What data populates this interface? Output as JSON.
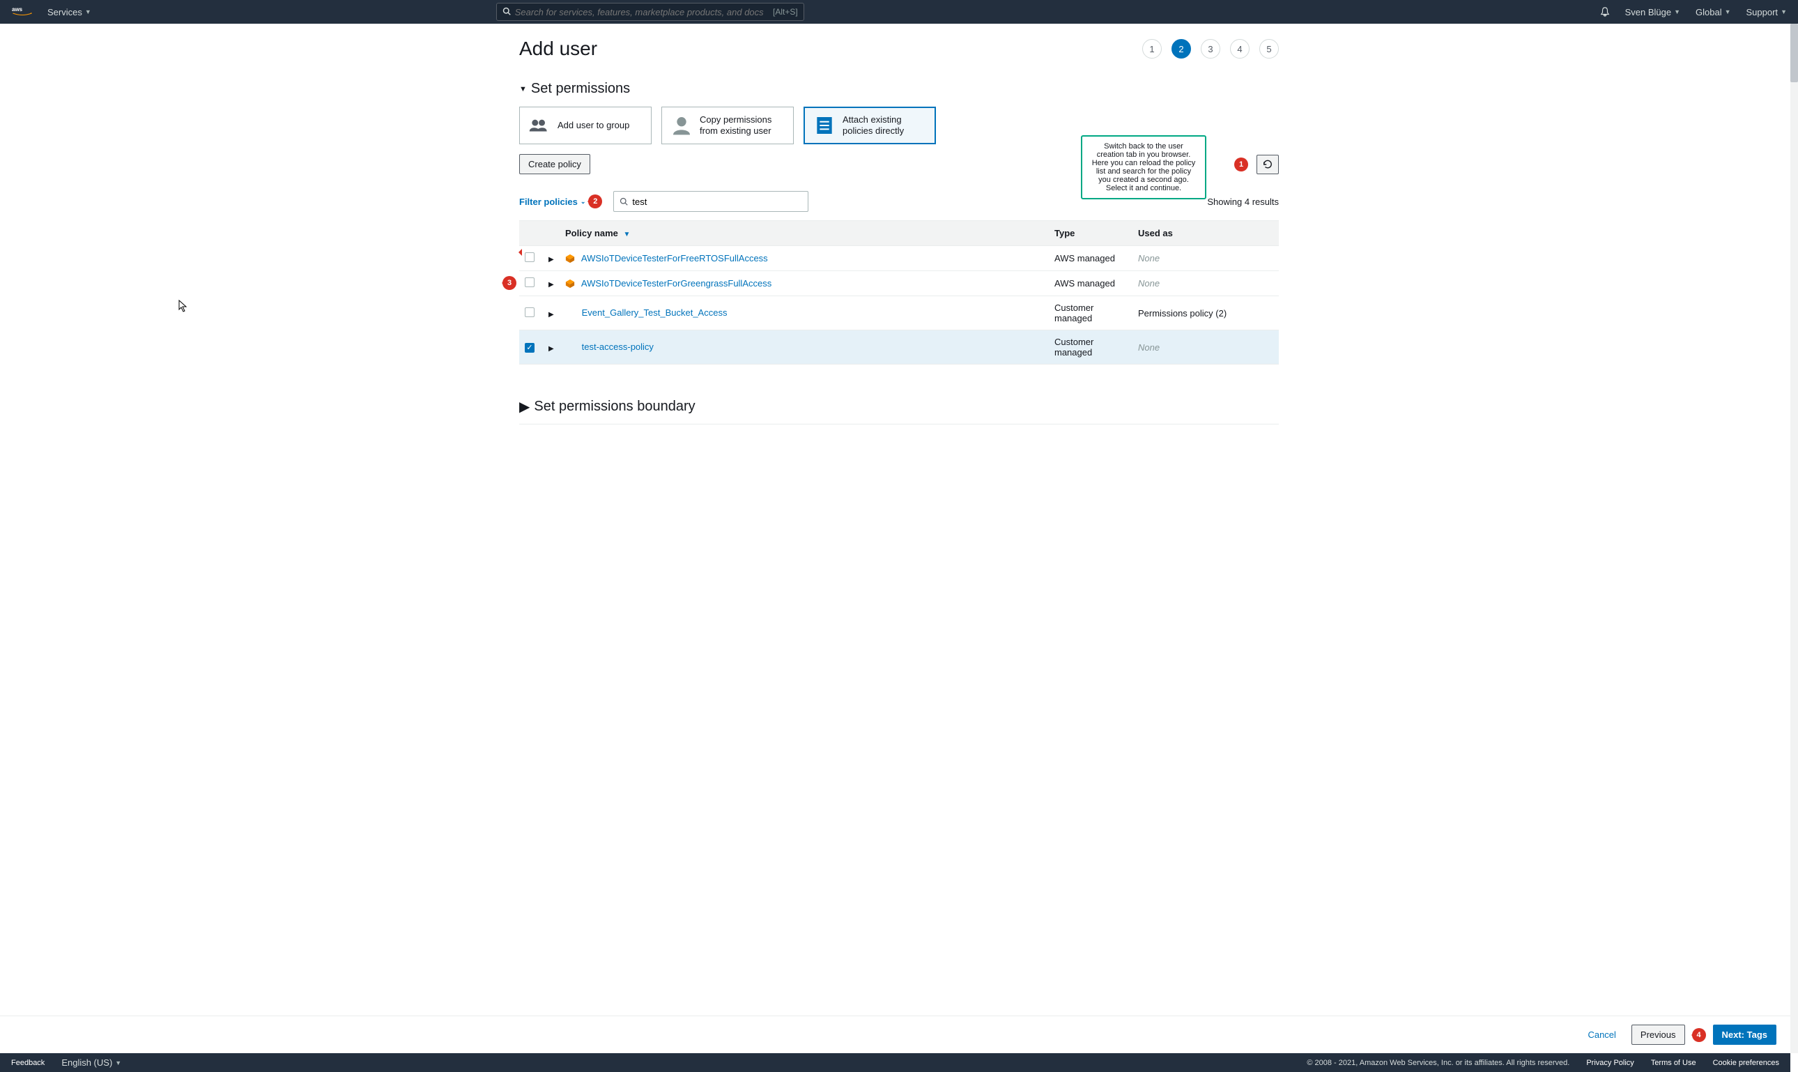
{
  "header": {
    "services": "Services",
    "search_placeholder": "Search for services, features, marketplace products, and docs",
    "search_hint": "[Alt+S]",
    "username": "Sven Blüge",
    "region": "Global",
    "support": "Support"
  },
  "page": {
    "title": "Add user",
    "steps": [
      "1",
      "2",
      "3",
      "4",
      "5"
    ],
    "active_step_index": 1
  },
  "permissions": {
    "section_title": "Set permissions",
    "cards": {
      "add_group": "Add user to group",
      "copy_user": "Copy permissions from existing user",
      "attach": "Attach existing policies directly"
    },
    "create_policy_btn": "Create policy",
    "filter_label": "Filter policies",
    "search_value": "test",
    "results_text": "Showing 4 results",
    "columns": {
      "name": "Policy name",
      "type": "Type",
      "used": "Used as"
    },
    "rows": [
      {
        "checked": false,
        "managed_icon": true,
        "name": "AWSIoTDeviceTesterForFreeRTOSFullAccess",
        "type": "AWS managed",
        "used": "None",
        "used_none": true
      },
      {
        "checked": false,
        "managed_icon": true,
        "name": "AWSIoTDeviceTesterForGreengrassFullAccess",
        "type": "AWS managed",
        "used": "None",
        "used_none": true
      },
      {
        "checked": false,
        "managed_icon": false,
        "name": "Event_Gallery_Test_Bucket_Access",
        "type": "Customer managed",
        "used": "Permissions policy (2)",
        "used_none": false
      },
      {
        "checked": true,
        "managed_icon": false,
        "name": "test-access-policy",
        "type": "Customer managed",
        "used": "None",
        "used_none": true
      }
    ]
  },
  "boundary": {
    "title": "Set permissions boundary"
  },
  "wizard_nav": {
    "cancel": "Cancel",
    "previous": "Previous",
    "next": "Next: Tags"
  },
  "footer": {
    "feedback": "Feedback",
    "language": "English (US)",
    "copyright": "© 2008 - 2021, Amazon Web Services, Inc. or its affiliates. All rights reserved.",
    "privacy": "Privacy Policy",
    "terms": "Terms of Use",
    "cookies": "Cookie preferences"
  },
  "annotations": {
    "m1": "1",
    "m2": "2",
    "m3": "3",
    "m4": "4",
    "tip": "Switch back to the user creation tab in you browser. Here you can reload the policy list and search for the policy you created a second ago. Select it and continue."
  }
}
